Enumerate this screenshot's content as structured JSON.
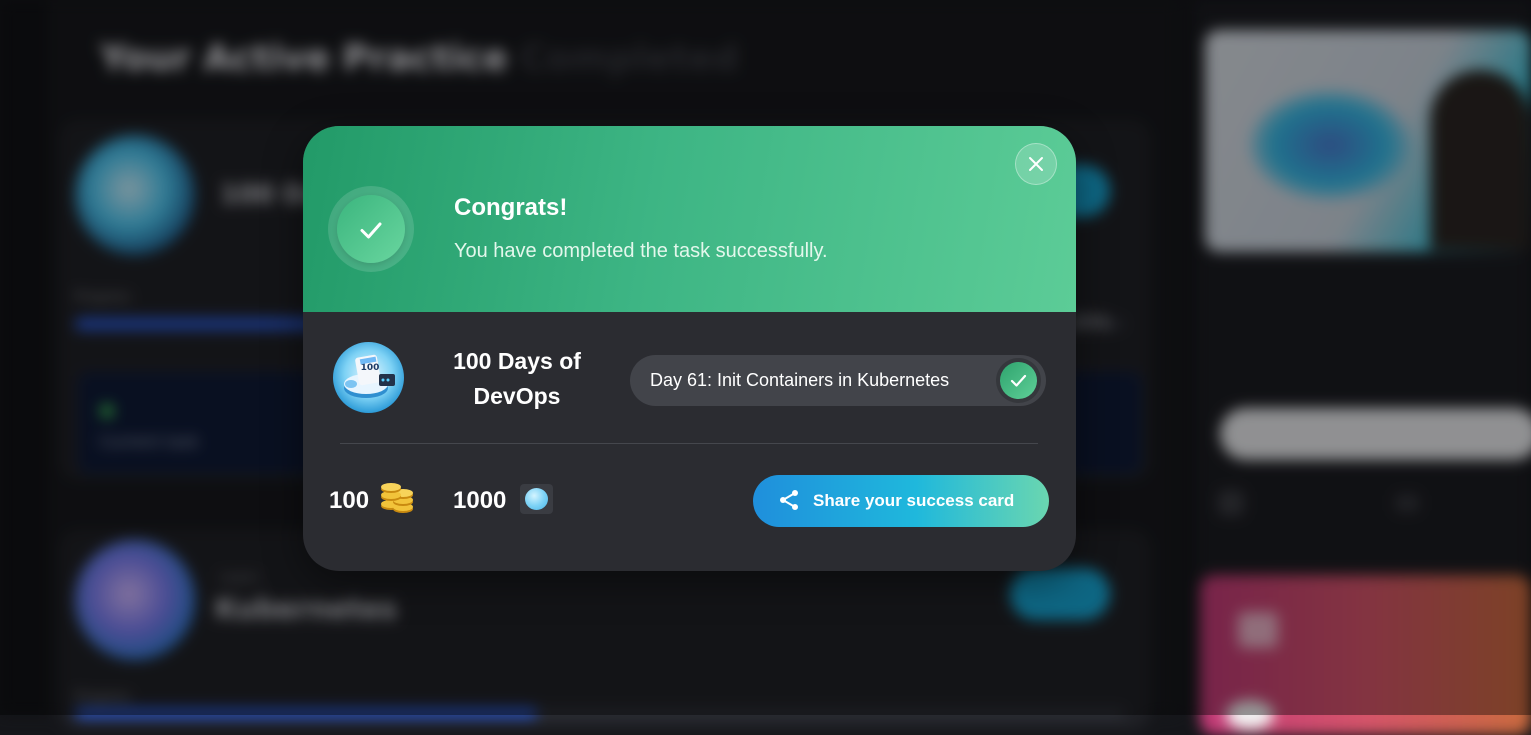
{
  "background": {
    "heading": "Your Active Practice",
    "tab_completed": "Completed",
    "card1_title": "100 Days",
    "card1_progress_label": "Progress",
    "card1_progress": 0.24,
    "card1_percent": "25%",
    "card1_panel_text": "Current task",
    "card2_subtitle": "Learn",
    "card2_title": "Kubernetes",
    "card2_progress_label": "Progress",
    "card2_progress": 0.44,
    "right_text": "",
    "right_button": "",
    "promo_title": "",
    "promo_sub": ""
  },
  "modal": {
    "title": "Congrats!",
    "message": "You have completed the task successfully.",
    "course_name": "100 Days of DevOps",
    "task_label": "Day 61: Init Containers in Kubernetes",
    "coins_value": "100",
    "gems_value": "1000",
    "share_label": "Share your success card",
    "icons": {
      "badge": "check-icon",
      "close": "close-icon",
      "task_done": "check-icon",
      "coins": "coins-icon",
      "gem": "gem-icon",
      "share": "share-icon"
    },
    "colors": {
      "header_start": "#229a68",
      "header_end": "#5ccc97",
      "body": "#2b2c31",
      "share_start": "#1f8fdc",
      "share_end": "#6ad6b0"
    }
  }
}
